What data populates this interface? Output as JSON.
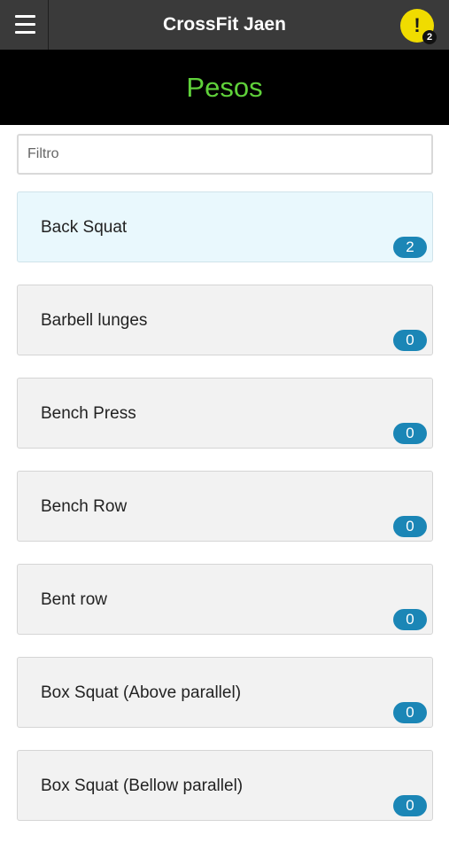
{
  "topbar": {
    "menu_icon": "hamburger-menu-icon",
    "title": "CrossFit Jaen",
    "alert_icon": "exclamation-icon",
    "alert_symbol": "!",
    "alert_count": "2",
    "alert_color": "#f0dc00"
  },
  "header": {
    "title": "Pesos",
    "title_color": "#5fd13a"
  },
  "filter": {
    "placeholder": "Filtro",
    "value": ""
  },
  "items": [
    {
      "label": "Back Squat",
      "count": "2",
      "selected": true
    },
    {
      "label": "Barbell lunges",
      "count": "0",
      "selected": false
    },
    {
      "label": "Bench Press",
      "count": "0",
      "selected": false
    },
    {
      "label": "Bench Row",
      "count": "0",
      "selected": false
    },
    {
      "label": "Bent row",
      "count": "0",
      "selected": false
    },
    {
      "label": "Box Squat (Above parallel)",
      "count": "0",
      "selected": false
    },
    {
      "label": "Box Squat (Bellow parallel)",
      "count": "0",
      "selected": false
    }
  ],
  "colors": {
    "badge": "#1b86b6",
    "selected_bg": "#e9f8fd",
    "item_bg": "#f2f2f2"
  }
}
